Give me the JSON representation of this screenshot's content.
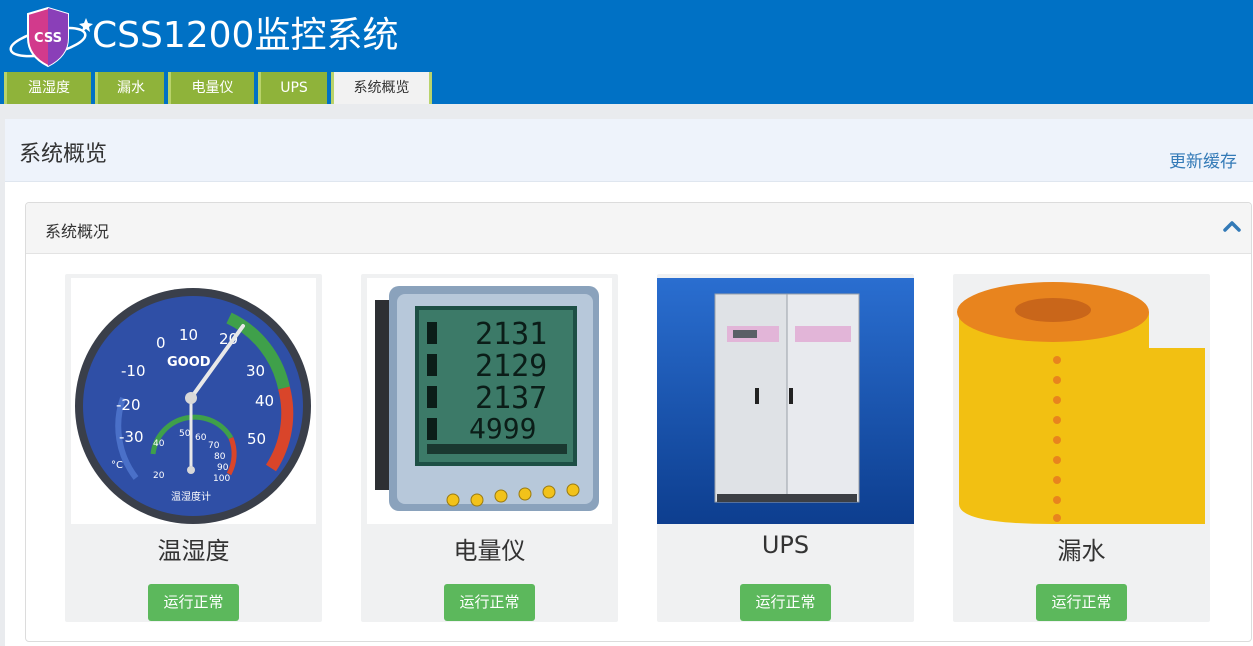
{
  "header": {
    "logo_text": "CSS",
    "title": "CSS1200监控系统"
  },
  "tabs": [
    {
      "label": "温湿度",
      "active": false
    },
    {
      "label": "漏水",
      "active": false
    },
    {
      "label": "电量仪",
      "active": false
    },
    {
      "label": "UPS",
      "active": false
    },
    {
      "label": "系统概览",
      "active": true
    }
  ],
  "page": {
    "title": "系统概览",
    "refresh_label": "更新缓存"
  },
  "panel": {
    "title": "系统概况"
  },
  "cards": [
    {
      "name": "温湿度",
      "status": "运行正常",
      "image": "thermo-hygrometer"
    },
    {
      "name": "电量仪",
      "status": "运行正常",
      "image": "power-meter"
    },
    {
      "name": "UPS",
      "status": "运行正常",
      "image": "ups-cabinet"
    },
    {
      "name": "漏水",
      "status": "运行正常",
      "image": "water-leak-cable"
    }
  ],
  "gauge_text": {
    "top_ticks": [
      "0",
      "10",
      "20"
    ],
    "left_ticks": [
      "-10",
      "-20",
      "-30"
    ],
    "right_ticks": [
      "30",
      "40",
      "50"
    ],
    "inner_ticks": [
      "40",
      "50",
      "60",
      "70",
      "80",
      "90",
      "100",
      "20"
    ],
    "brand": "GOOD",
    "unit": "°C",
    "caption": "温湿度计"
  },
  "meter_text": {
    "rows": [
      "2131",
      "2129",
      "2137",
      "4999"
    ]
  },
  "colors": {
    "header_bg": "#0071c5",
    "tab_bg": "#8fb33a",
    "status_green": "#5cb85c",
    "link_blue": "#337ab7"
  }
}
